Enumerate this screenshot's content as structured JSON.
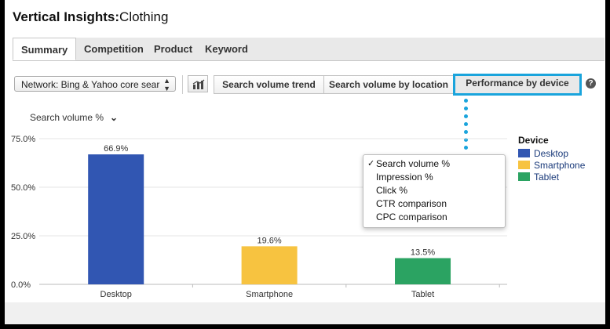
{
  "header": {
    "title_bold": "Vertical Insights:",
    "title_rest": "Clothing"
  },
  "tabs": [
    {
      "label": "Summary",
      "active": true
    },
    {
      "label": "Competition",
      "active": false
    },
    {
      "label": "Product",
      "active": false
    },
    {
      "label": "Keyword",
      "active": false
    }
  ],
  "toolbar": {
    "network_value": "Network: Bing & Yahoo core sear",
    "segments": [
      {
        "label": "Search volume trend",
        "active": false
      },
      {
        "label": "Search volume by location",
        "active": false
      },
      {
        "label": "Performance by device",
        "active": true
      }
    ],
    "help_label": "?",
    "accent_color": "#1aa4dc"
  },
  "metric_selector": {
    "label": "Search volume %"
  },
  "dropdown": {
    "checked_index": 0,
    "options": [
      "Search volume %",
      "Impression %",
      "Click %",
      "CTR comparison",
      "CPC comparison"
    ]
  },
  "chart_data": {
    "type": "bar",
    "categories": [
      "Desktop",
      "Smartphone",
      "Tablet"
    ],
    "values": [
      66.9,
      19.6,
      13.5
    ],
    "value_labels": [
      "66.9%",
      "19.6%",
      "13.5%"
    ],
    "colors": [
      "#3156b2",
      "#f7c340",
      "#2ba362"
    ],
    "ylim": [
      0,
      75
    ],
    "yticks": [
      0,
      25,
      50,
      75
    ],
    "ytick_labels": [
      "0.0%",
      "25.0%",
      "50.0%",
      "75.0%"
    ],
    "grid": true,
    "legend": {
      "title": "Device",
      "placement": "right",
      "entries": [
        "Desktop",
        "Smartphone",
        "Tablet"
      ]
    }
  }
}
